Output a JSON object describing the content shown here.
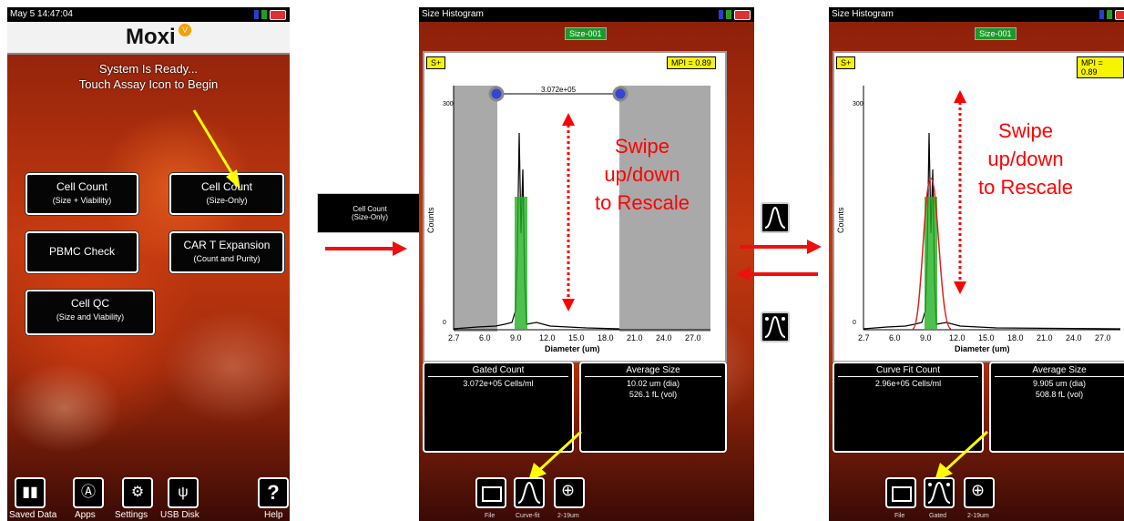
{
  "screen1": {
    "status_time": "May 5 14:47:04",
    "logo_text": "Moxi",
    "ready_line1": "System Is Ready...",
    "ready_line2": "Touch Assay Icon to Begin",
    "tiles": [
      {
        "title": "Cell Count",
        "sub": "(Size + Viability)"
      },
      {
        "title": "Cell Count",
        "sub": "(Size-Only)"
      },
      {
        "title": "PBMC Check",
        "sub": ""
      },
      {
        "title": "CAR T Expansion",
        "sub": "(Count and Purity)"
      },
      {
        "title": "Cell QC",
        "sub": "(Size and Viability)"
      }
    ],
    "dock": [
      "Saved Data",
      "Apps",
      "Settings",
      "USB Disk",
      "Help"
    ]
  },
  "callout": {
    "title": "Cell Count",
    "sub": "(Size-Only)"
  },
  "screen2": {
    "title": "Size Histogram",
    "size_badge": "Size-001",
    "tag_left": "S+",
    "tag_right": "MPI = 0.89",
    "gate_label": "3.072e+05",
    "y_label": "Counts",
    "y_tick_top": "300",
    "y_tick_zero": "0",
    "x_label": "Diameter (um)",
    "x_ticks": [
      "2.7",
      "6.0",
      "9.0",
      "12.0",
      "15.0",
      "18.0",
      "21.0",
      "24.0",
      "27.0"
    ],
    "stat_left_head": "Gated Count",
    "stat_left_val": "3.072e+05 Cells/ml",
    "stat_right_head": "Average Size",
    "stat_right_val1": "10.02 um (dia)",
    "stat_right_val2": "526.1 fL (vol)",
    "btn_labels": [
      "File",
      "Curve-fit",
      "2-19um"
    ],
    "swipe_text": [
      "Swipe",
      "up/down",
      "to Rescale"
    ]
  },
  "screen3": {
    "title": "Size Histogram",
    "size_badge": "Size-001",
    "tag_left": "S+",
    "tag_right": "MPI = 0.89",
    "y_label": "Counts",
    "y_tick_top": "300",
    "y_tick_zero": "0",
    "x_label": "Diameter (um)",
    "x_ticks": [
      "2.7",
      "6.0",
      "9.0",
      "12.0",
      "15.0",
      "18.0",
      "21.0",
      "24.0",
      "27.0"
    ],
    "stat_left_head": "Curve Fit Count",
    "stat_left_val": "2.96e+05 Cells/ml",
    "stat_right_head": "Average Size",
    "stat_right_val1": "9.905 um (dia)",
    "stat_right_val2": "508.8 fL (vol)",
    "btn_labels": [
      "File",
      "Gated",
      "2-19um"
    ],
    "swipe_text": [
      "Swipe",
      "up/down",
      "to Rescale"
    ]
  },
  "colors": {
    "accent_red": "#ff0000",
    "highlight_yellow": "#f7f400",
    "badge_green": "#1a9a2a"
  }
}
